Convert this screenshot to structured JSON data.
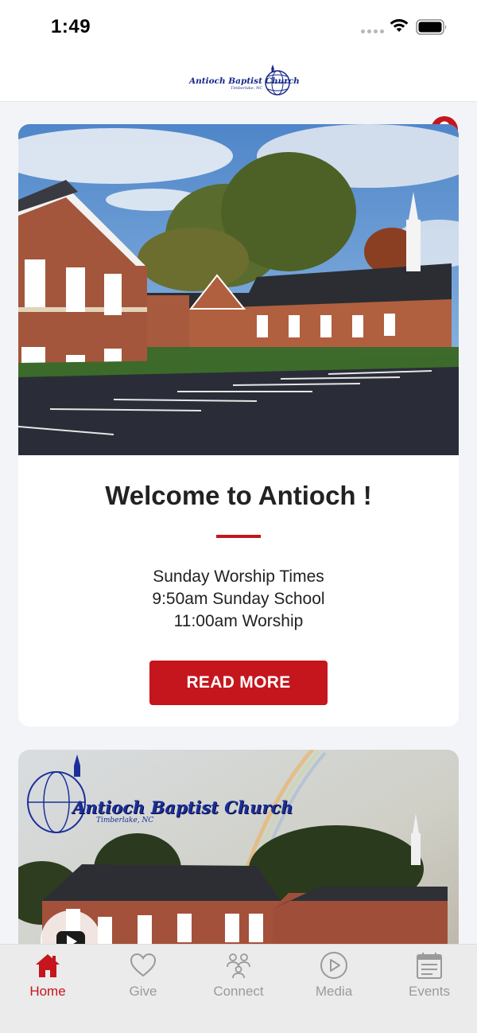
{
  "status_bar": {
    "time": "1:49"
  },
  "header": {
    "logo_text": "Antioch Baptist Church",
    "logo_subtext": "Timberlake, NC",
    "profile_icon": "user-icon"
  },
  "welcome_card": {
    "title": "Welcome to Antioch !",
    "times": [
      "Sunday Worship Times",
      "9:50am Sunday School",
      "11:00am Worship"
    ],
    "button_label": "READ MORE"
  },
  "media_card": {
    "logo_text": "Antioch Baptist Church",
    "logo_subtext": "Timberlake, NC",
    "play_icon": "youtube-play-icon"
  },
  "tab_bar": {
    "tabs": [
      {
        "label": "Home",
        "icon": "home-icon",
        "active": true
      },
      {
        "label": "Give",
        "icon": "heart-icon",
        "active": false
      },
      {
        "label": "Connect",
        "icon": "people-icon",
        "active": false
      },
      {
        "label": "Media",
        "icon": "play-circle-icon",
        "active": false
      },
      {
        "label": "Events",
        "icon": "calendar-icon",
        "active": false
      }
    ]
  },
  "colors": {
    "accent": "#c4161c",
    "inactive": "#9a9a9a",
    "tab_bg": "#ebebeb",
    "logo_blue": "#17288a"
  }
}
